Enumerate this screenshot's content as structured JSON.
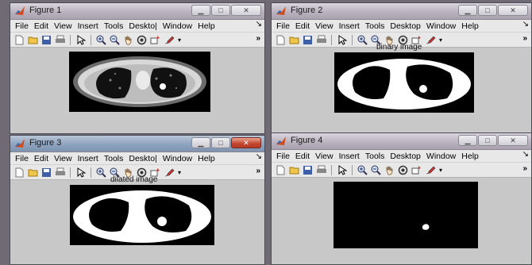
{
  "windows": [
    {
      "title": "Figure 1",
      "caption": ""
    },
    {
      "title": "Figure 2",
      "caption": "binary image"
    },
    {
      "title": "Figure 3",
      "caption": "dilated image"
    },
    {
      "title": "Figure 4",
      "caption": ""
    }
  ],
  "menu_short": [
    "File",
    "Edit",
    "View",
    "Insert",
    "Tools",
    "Deskto|",
    "Window",
    "Help"
  ],
  "menu_long": [
    "File",
    "Edit",
    "View",
    "Insert",
    "Tools",
    "Desktop",
    "Window",
    "Help"
  ],
  "toolbar_icons": [
    "new-file-icon",
    "open-folder-icon",
    "save-icon",
    "print-icon",
    "pointer-icon",
    "zoom-in-icon",
    "zoom-out-icon",
    "pan-hand-icon",
    "rotate-icon",
    "data-cursor-icon",
    "brush-icon"
  ],
  "overflow_glyph": "»",
  "dock_glyph": "↘",
  "active_window": "Figure 3",
  "colors": {
    "figure_bg": "#c8c8c8",
    "menu_bg": "#e8e8e8",
    "active_close": "#c4452f"
  }
}
